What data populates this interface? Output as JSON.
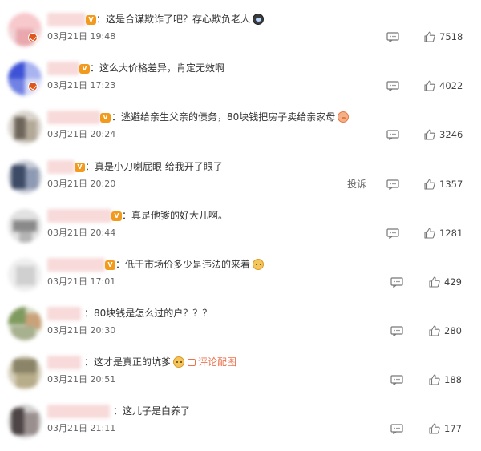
{
  "comments": [
    {
      "text": "：这是合谋欺诈了吧？存心欺负老人",
      "time": "03月21日 19:48",
      "likes": "7518",
      "emoji": "cry-icon"
    },
    {
      "text": "：这么大价格差异，肯定无效啊",
      "time": "03月21日 17:23",
      "likes": "4022"
    },
    {
      "text": "：逃避给亲生父亲的债务，80块钱把房子卖给亲家母",
      "time": "03月21日 20:24",
      "likes": "3246",
      "emoji": "pig-icon"
    },
    {
      "text": "：真是小刀喇屁眼 给我开了眼了",
      "time": "03月21日 20:20",
      "likes": "1357",
      "report": "投诉"
    },
    {
      "text": "：真是他爹的好大儿啊。",
      "time": "03月21日 20:44",
      "likes": "1281"
    },
    {
      "text": "：低于市场价多少是违法的来着",
      "time": "03月21日 17:01",
      "likes": "429",
      "emoji": "dog-icon"
    },
    {
      "text": "：80块钱是怎么过的户？？？",
      "time": "03月21日 20:30",
      "likes": "280"
    },
    {
      "text": "：这才是真正的坑爹",
      "time": "03月21日 20:51",
      "likes": "188",
      "emoji": "dog-icon",
      "attachment": "评论配图"
    },
    {
      "text": "：这儿子是白养了",
      "time": "03月21日 21:11",
      "likes": "177"
    }
  ],
  "colors": {
    "accent": "#eb7350",
    "vip_badge": "#f29a1c",
    "verified_badge": "#e0551b"
  }
}
